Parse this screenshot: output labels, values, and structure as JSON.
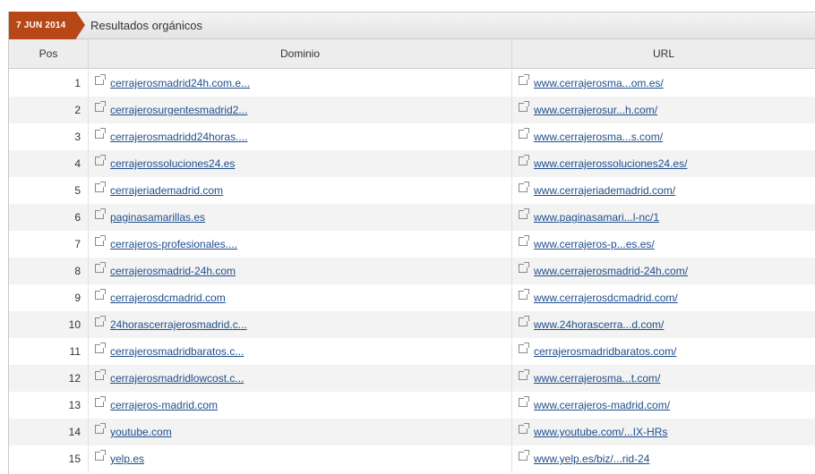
{
  "header": {
    "date_badge": "7 JUN 2014",
    "title": "Resultados orgánicos"
  },
  "columns": {
    "pos": "Pos",
    "domain": "Dominio",
    "url": "URL"
  },
  "colors": {
    "badge": "#b84718",
    "link": "#1f4e8c",
    "row_alt": "#f3f3f3"
  },
  "icons": {
    "external_link": "external-link-icon"
  },
  "rows": [
    {
      "pos": "1",
      "domain": "cerrajerosmadrid24h.com.e...",
      "url": "www.cerrajerosma...om.es/"
    },
    {
      "pos": "2",
      "domain": "cerrajerosurgentesmadrid2...",
      "url": "www.cerrajerosur...h.com/"
    },
    {
      "pos": "3",
      "domain": "cerrajerosmadridd24horas....",
      "url": "www.cerrajerosma...s.com/"
    },
    {
      "pos": "4",
      "domain": "cerrajerossoluciones24.es",
      "url": "www.cerrajerossoluciones24.es/"
    },
    {
      "pos": "5",
      "domain": "cerrajeriademadrid.com",
      "url": "www.cerrajeriademadrid.com/"
    },
    {
      "pos": "6",
      "domain": "paginasamarillas.es",
      "url": "www.paginasamari...l-nc/1"
    },
    {
      "pos": "7",
      "domain": "cerrajeros-profesionales....",
      "url": "www.cerrajeros-p...es.es/"
    },
    {
      "pos": "8",
      "domain": "cerrajerosmadrid-24h.com",
      "url": "www.cerrajerosmadrid-24h.com/"
    },
    {
      "pos": "9",
      "domain": "cerrajerosdcmadrid.com",
      "url": "www.cerrajerosdcmadrid.com/"
    },
    {
      "pos": "10",
      "domain": "24horascerrajerosmadrid.c...",
      "url": "www.24horascerra...d.com/"
    },
    {
      "pos": "11",
      "domain": "cerrajerosmadridbaratos.c...",
      "url": "cerrajerosmadridbaratos.com/"
    },
    {
      "pos": "12",
      "domain": "cerrajerosmadridlowcost.c...",
      "url": "www.cerrajerosma...t.com/"
    },
    {
      "pos": "13",
      "domain": "cerrajeros-madrid.com",
      "url": "www.cerrajeros-madrid.com/"
    },
    {
      "pos": "14",
      "domain": "youtube.com",
      "url": "www.youtube.com/...IX-HRs"
    },
    {
      "pos": "15",
      "domain": "yelp.es",
      "url": "www.yelp.es/biz/...rid-24"
    }
  ]
}
